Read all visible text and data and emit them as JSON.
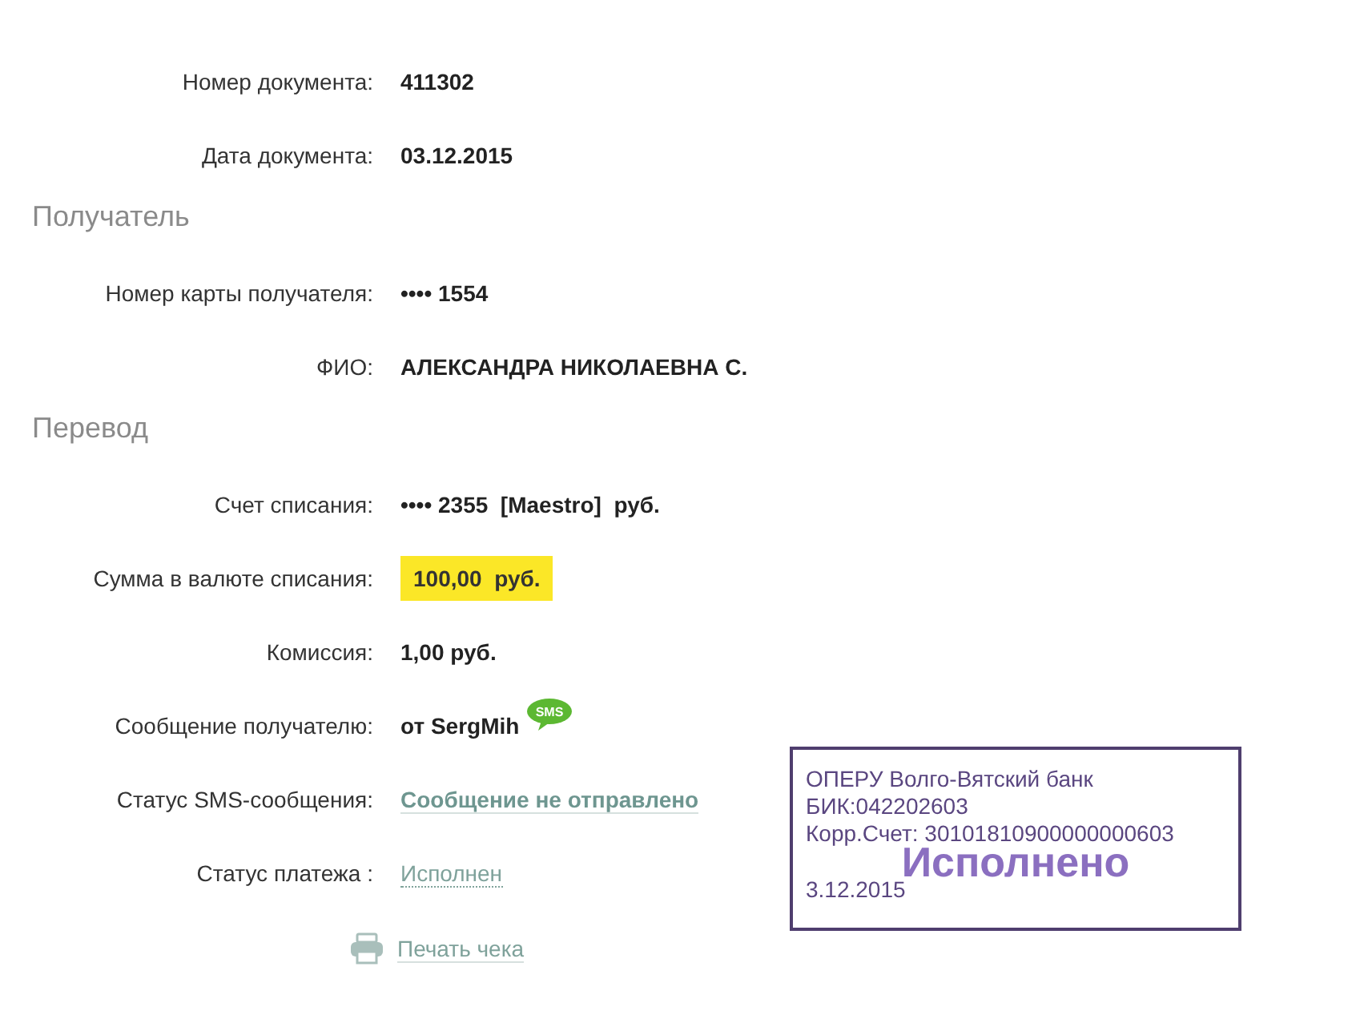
{
  "sections": [
    {
      "rows": [
        {
          "label": "Номер документа:",
          "value": "411302",
          "kind": "plain"
        },
        {
          "label": "Дата документа:",
          "value": "03.12.2015",
          "kind": "plain"
        }
      ]
    },
    {
      "heading": "Получатель",
      "rows": [
        {
          "label": "Номер карты получателя:",
          "value": "•••• 1554",
          "kind": "plain"
        },
        {
          "label": "ФИО:",
          "value": "АЛЕКСАНДРА НИКОЛАЕВНА С.",
          "kind": "plain"
        }
      ]
    },
    {
      "heading": "Перевод",
      "rows": [
        {
          "label": "Счет списания:",
          "value": "•••• 2355  [Maestro]  руб.",
          "kind": "plain"
        },
        {
          "label": "Сумма в валюте списания:",
          "value": "100,00  руб.",
          "kind": "highlight"
        },
        {
          "label": "Комиссия:",
          "value": "1,00 руб.",
          "kind": "plain"
        },
        {
          "label": "Сообщение получателю:",
          "value": "от SergMih",
          "kind": "sms",
          "badge": "SMS"
        },
        {
          "label": "Статус SMS-сообщения:",
          "value": "Сообщение не отправлено",
          "kind": "status"
        },
        {
          "label": "Статус платежа :",
          "value": "Исполнен",
          "kind": "dotted-link"
        }
      ]
    }
  ],
  "print_link": "Печать чека",
  "stamp": {
    "lines": [
      "ОПЕРУ Волго-Вятский банк",
      "БИК:042202603",
      "Корр.Счет: 30101810900000000603"
    ],
    "title": "Исполнено",
    "date": "3.12.2015"
  }
}
